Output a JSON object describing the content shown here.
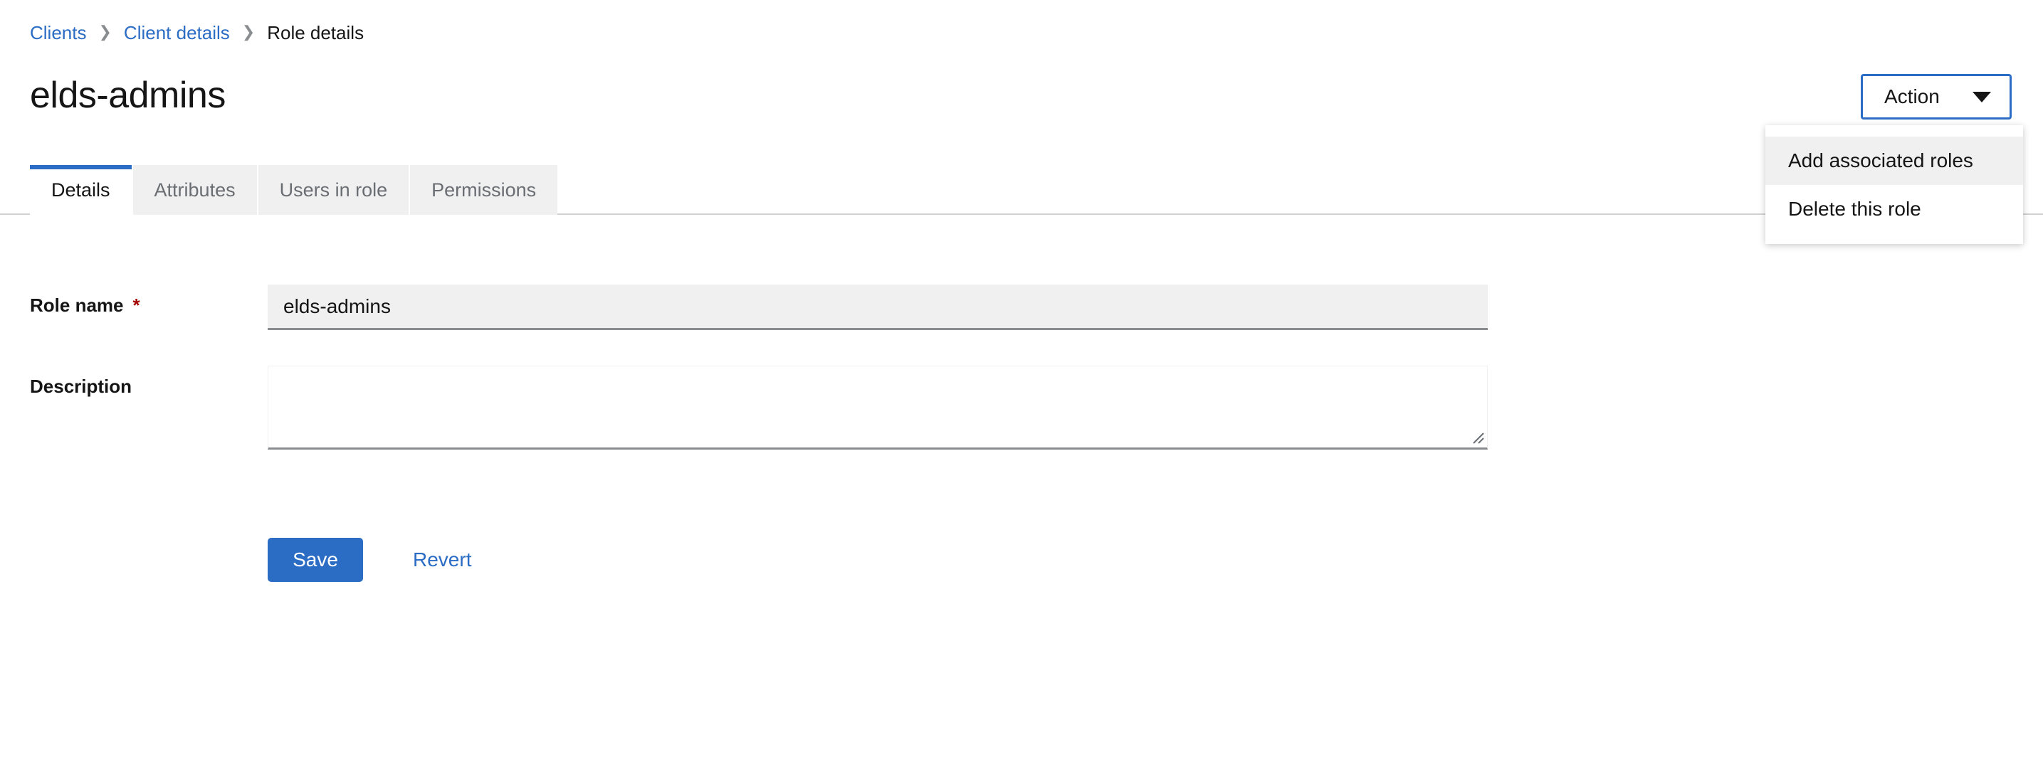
{
  "breadcrumb": {
    "separator_icon": "chevron-right-icon",
    "items": [
      {
        "label": "Clients",
        "is_link": true
      },
      {
        "label": "Client details",
        "is_link": true
      },
      {
        "label": "Role details",
        "is_link": false
      }
    ]
  },
  "header": {
    "title": "elds-admins",
    "action": {
      "label": "Action",
      "caret_icon": "caret-down-icon",
      "expanded": true,
      "menu_items": [
        {
          "label": "Add associated roles",
          "hovered": true
        },
        {
          "label": "Delete this role",
          "hovered": false
        }
      ]
    }
  },
  "tabs": [
    {
      "label": "Details",
      "active": true
    },
    {
      "label": "Attributes",
      "active": false
    },
    {
      "label": "Users in role",
      "active": false
    },
    {
      "label": "Permissions",
      "active": false
    }
  ],
  "form": {
    "role_name": {
      "label": "Role name",
      "required_marker": "*",
      "value": "elds-admins",
      "placeholder": "",
      "disabled": true
    },
    "description": {
      "label": "Description",
      "value": "",
      "placeholder": "",
      "resize_handle_icon": "resize-grip-icon"
    },
    "save_label": "Save",
    "revert_label": "Revert"
  },
  "colors": {
    "accent_blue": "#2b6cc4",
    "link_blue": "#2b6cc4",
    "required_red": "#a30000",
    "muted_gray": "#6a6e73",
    "surface_gray": "#f0f0f0",
    "rule_gray": "#d2d2d2"
  }
}
